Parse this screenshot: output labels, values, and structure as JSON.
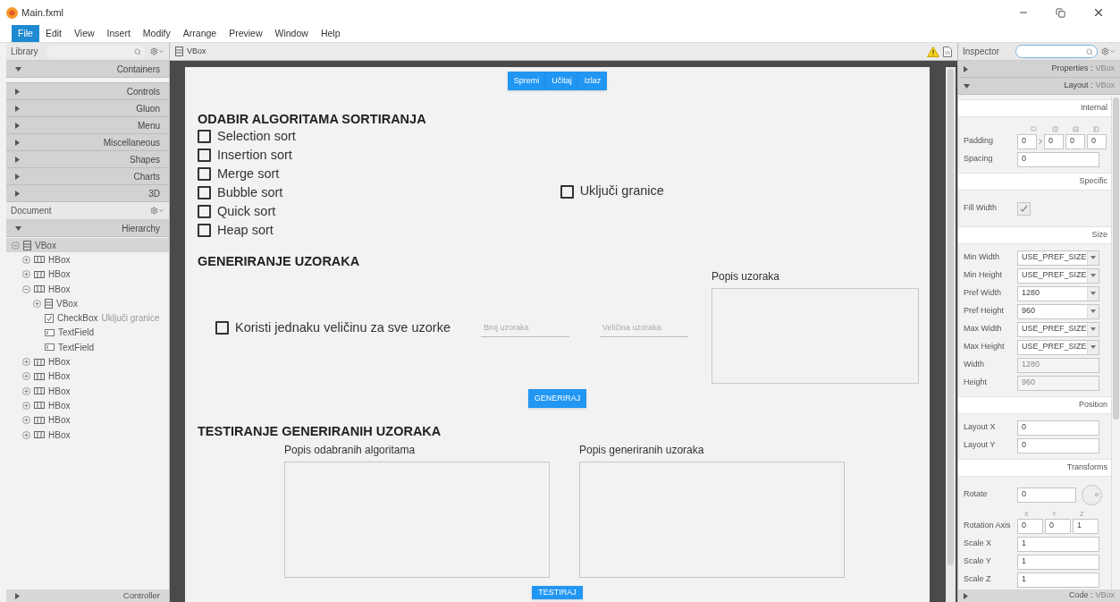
{
  "window": {
    "title": "Main.fxml"
  },
  "menu": [
    {
      "label": "File",
      "selected": true
    },
    {
      "label": "Edit",
      "selected": false
    },
    {
      "label": "View",
      "selected": false
    },
    {
      "label": "Insert",
      "selected": false
    },
    {
      "label": "Modify",
      "selected": false
    },
    {
      "label": "Arrange",
      "selected": false
    },
    {
      "label": "Preview",
      "selected": false
    },
    {
      "label": "Window",
      "selected": false
    },
    {
      "label": "Help",
      "selected": false
    }
  ],
  "library": {
    "title": "Library",
    "sections": [
      {
        "label": "Containers",
        "expanded": true
      },
      {
        "label": "Controls",
        "expanded": false
      },
      {
        "label": "Gluon",
        "expanded": false
      },
      {
        "label": "Menu",
        "expanded": false
      },
      {
        "label": "Miscellaneous",
        "expanded": false
      },
      {
        "label": "Shapes",
        "expanded": false
      },
      {
        "label": "Charts",
        "expanded": false
      },
      {
        "label": "3D",
        "expanded": false
      }
    ]
  },
  "document": {
    "title": "Document",
    "section": {
      "label": "Hierarchy",
      "expanded": true
    },
    "tree": [
      {
        "kind": "vbox",
        "name": "VBox",
        "expanded": true,
        "selected": true,
        "children": [
          {
            "kind": "hbox",
            "name": "HBox",
            "expanded": false,
            "selected": false
          },
          {
            "kind": "hbox",
            "name": "HBox",
            "expanded": false,
            "selected": false
          },
          {
            "kind": "hbox",
            "name": "HBox",
            "expanded": true,
            "selected": false,
            "children": [
              {
                "kind": "vbox",
                "name": "VBox",
                "expanded": false,
                "selected": false
              },
              {
                "kind": "checkbox",
                "name": "CheckBox",
                "text": "Uključi granice",
                "selected": false
              },
              {
                "kind": "textfield",
                "name": "TextField",
                "selected": false
              },
              {
                "kind": "textfield",
                "name": "TextField",
                "selected": false
              }
            ]
          },
          {
            "kind": "hbox",
            "name": "HBox",
            "expanded": false,
            "selected": false
          },
          {
            "kind": "hbox",
            "name": "HBox",
            "expanded": false,
            "selected": false
          },
          {
            "kind": "hbox",
            "name": "HBox",
            "expanded": false,
            "selected": false
          },
          {
            "kind": "hbox",
            "name": "HBox",
            "expanded": false,
            "selected": false
          },
          {
            "kind": "hbox",
            "name": "HBox",
            "expanded": false,
            "selected": false
          },
          {
            "kind": "hbox",
            "name": "HBox",
            "expanded": false,
            "selected": false
          }
        ]
      }
    ],
    "controller": {
      "label": "Controller",
      "expanded": false
    }
  },
  "canvas": {
    "breadcrumb": "VBox",
    "form": {
      "toolbar": [
        {
          "label": "Spremi"
        },
        {
          "label": "Učitaj"
        },
        {
          "label": "Izlaz"
        }
      ],
      "algorithms": {
        "heading": "ODABIR ALGORITAMA SORTIRANJA",
        "options": [
          {
            "label": "Selection sort",
            "checked": false
          },
          {
            "label": "Insertion sort",
            "checked": false
          },
          {
            "label": "Merge sort",
            "checked": false
          },
          {
            "label": "Bubble sort",
            "checked": false
          },
          {
            "label": "Quick sort",
            "checked": false
          },
          {
            "label": "Heap sort",
            "checked": false
          }
        ],
        "bounds": {
          "label": "Uključi granice",
          "checked": false
        }
      },
      "generation": {
        "heading": "GENERIRANJE UZORAKA",
        "equal_size": {
          "label": "Koristi jednaku veličinu za sve uzorke",
          "checked": false
        },
        "count_field": {
          "placeholder": "Broj uzoraka"
        },
        "size_field": {
          "placeholder": "Veličina uzoraka"
        },
        "samples_list": {
          "label": "Popis uzoraka"
        },
        "button": "GENERIRAJ"
      },
      "testing": {
        "heading": "TESTIRANJE GENERIRANIH UZORAKA",
        "algorithms_list": {
          "label": "Popis odabranih algoritama"
        },
        "samples_list": {
          "label": "Popis generiranih uzoraka"
        },
        "button": "TESTIRAJ"
      }
    }
  },
  "inspector": {
    "title": "Inspector",
    "sections": [
      {
        "label": "Properties :",
        "target": "VBox",
        "expanded": false
      },
      {
        "label": "Layout :",
        "target": "VBox",
        "expanded": true
      }
    ],
    "groups": [
      {
        "title": "Internal",
        "rows": [
          {
            "kind": "padding",
            "label": "Padding",
            "values": [
              "0",
              "0",
              "0",
              "0"
            ]
          },
          {
            "kind": "text",
            "label": "Spacing",
            "value": "0",
            "disabled": false
          }
        ]
      },
      {
        "title": "Specific",
        "rows": [
          {
            "kind": "check",
            "label": "Fill Width",
            "checked": true
          }
        ]
      },
      {
        "title": "Size",
        "rows": [
          {
            "kind": "combo",
            "label": "Min Width",
            "value": "USE_PREF_SIZE"
          },
          {
            "kind": "combo",
            "label": "Min Height",
            "value": "USE_PREF_SIZE"
          },
          {
            "kind": "combo",
            "label": "Pref Width",
            "value": "1280"
          },
          {
            "kind": "combo",
            "label": "Pref Height",
            "value": "960"
          },
          {
            "kind": "combo",
            "label": "Max Width",
            "value": "USE_PREF_SIZE"
          },
          {
            "kind": "combo",
            "label": "Max Height",
            "value": "USE_PREF_SIZE"
          },
          {
            "kind": "text",
            "label": "Width",
            "value": "1280",
            "disabled": true
          },
          {
            "kind": "text",
            "label": "Height",
            "value": "960",
            "disabled": true
          }
        ]
      },
      {
        "title": "Position",
        "rows": [
          {
            "kind": "text",
            "label": "Layout X",
            "value": "0",
            "disabled": false
          },
          {
            "kind": "text",
            "label": "Layout Y",
            "value": "0",
            "disabled": false
          }
        ]
      },
      {
        "title": "Transforms",
        "rows": [
          {
            "kind": "rotate",
            "label": "Rotate",
            "value": "0"
          },
          {
            "kind": "axis",
            "label": "Rotation Axis",
            "axes": [
              "X",
              "Y",
              "Z"
            ],
            "values": [
              "0",
              "0",
              "1"
            ]
          },
          {
            "kind": "text",
            "label": "Scale X",
            "value": "1",
            "disabled": false
          },
          {
            "kind": "text",
            "label": "Scale Y",
            "value": "1",
            "disabled": false
          },
          {
            "kind": "text",
            "label": "Scale Z",
            "value": "1",
            "disabled": false
          }
        ]
      }
    ],
    "footer": {
      "label": "Code :",
      "target": "VBox",
      "expanded": false
    }
  }
}
